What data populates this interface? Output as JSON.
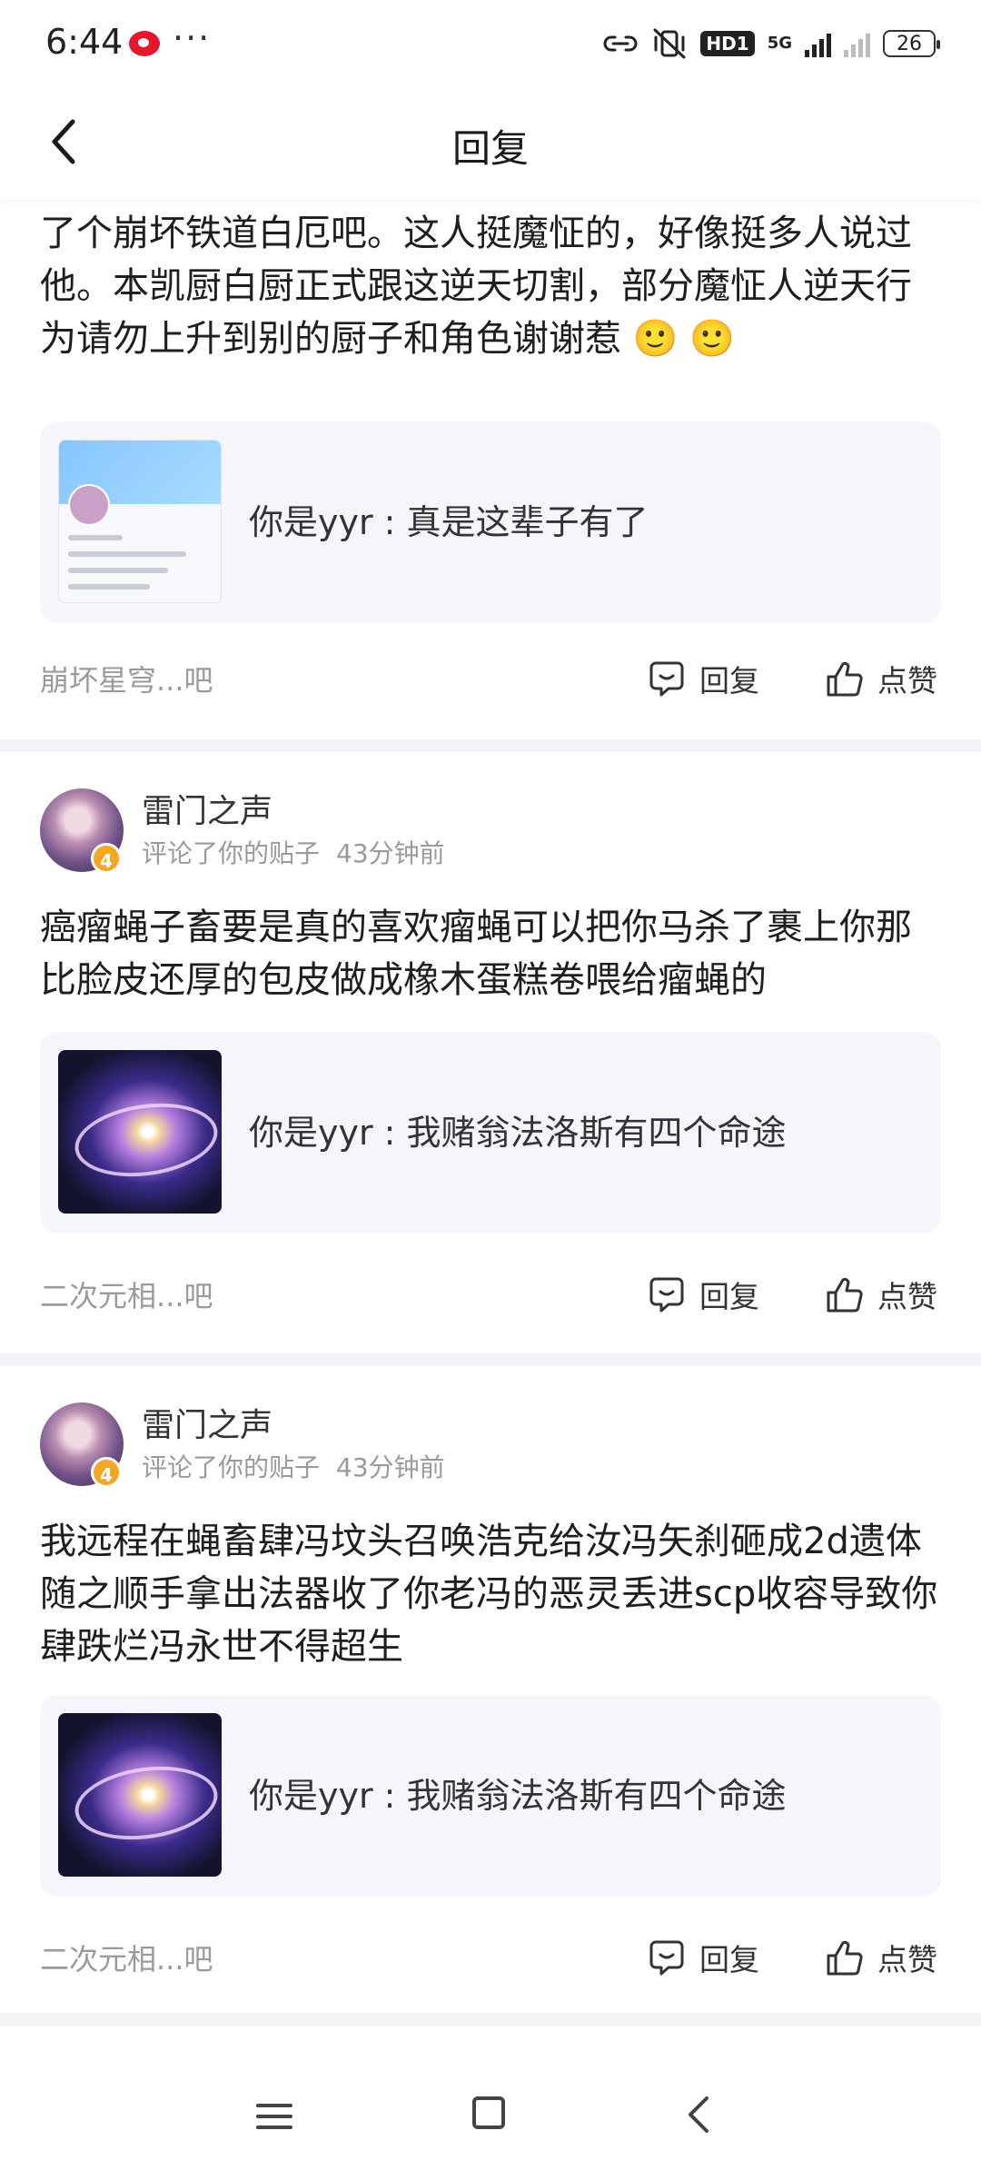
{
  "status_bar": {
    "time": "6:44",
    "dots": "···",
    "network_badge": "HD1",
    "network_type": "5G",
    "battery": "26"
  },
  "header": {
    "title": "回复"
  },
  "notifications": [
    {
      "text": "起来了，白厄吧之前因为封了他，所以他应该是另外开了个崩坏铁道白厄吧。这人挺魔怔的，好像挺多人说过他。本凯厨白厨正式跟这逆天切割，部分魔怔人逆天行为请勿上升到别的厨子和角色谢谢惹 🙂 🙂",
      "quote": "你是yyr : 真是这辈子有了",
      "forum": "崩坏星穹...吧",
      "reply_label": "回复",
      "like_label": "点赞"
    },
    {
      "username": "雷门之声",
      "level": "4",
      "action": "评论了你的贴子",
      "time": "43分钟前",
      "text": "癌瘤蝇子畜要是真的喜欢瘤蝇可以把你马杀了裹上你那比脸皮还厚的包皮做成橡木蛋糕卷喂给瘤蝇的",
      "quote": "你是yyr : 我赌翁法洛斯有四个命途",
      "forum": "二次元相...吧",
      "reply_label": "回复",
      "like_label": "点赞"
    },
    {
      "username": "雷门之声",
      "level": "4",
      "action": "评论了你的贴子",
      "time": "43分钟前",
      "text": "我远程在蝇畜肆冯坟头召唤浩克给汝冯矢刹砸成2d遗体随之顺手拿出法器收了你老冯的恶灵丢进scp收容导致你肆跌烂冯永世不得超生",
      "quote": "你是yyr : 我赌翁法洛斯有四个命途",
      "forum": "二次元相...吧",
      "reply_label": "回复",
      "like_label": "点赞"
    }
  ],
  "colors": {
    "quote_bg": "#f5f6fb",
    "separator": "#f3f3f7",
    "muted_text": "#9a9a9a",
    "level_badge": "#f5a623"
  }
}
